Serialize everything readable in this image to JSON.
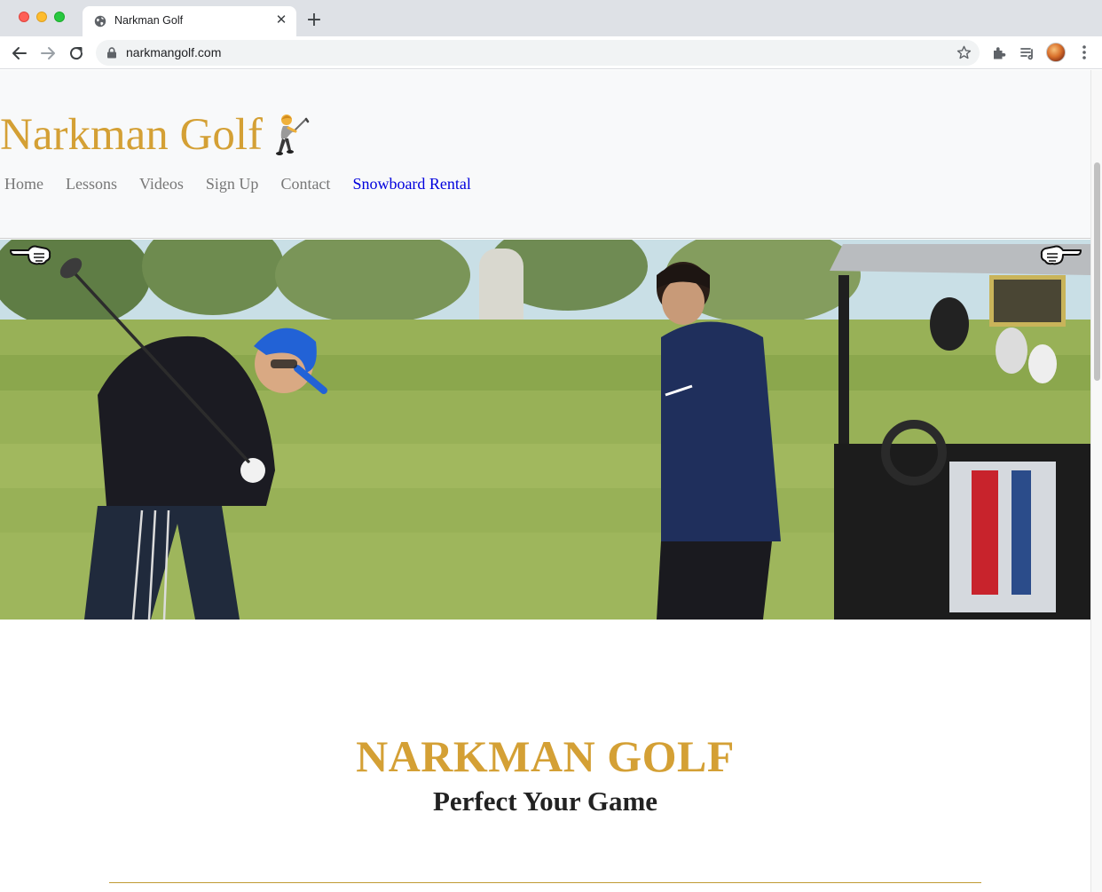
{
  "browser": {
    "tab_title": "Narkman Golf",
    "tab_close": "✕",
    "new_tab": "+",
    "url": "narkmangolf.com"
  },
  "site": {
    "brand": "Narkman Golf",
    "brand_emoji": "golfer-icon",
    "nav": [
      {
        "label": "Home"
      },
      {
        "label": "Lessons"
      },
      {
        "label": "Videos"
      },
      {
        "label": "Sign Up"
      },
      {
        "label": "Contact"
      },
      {
        "label": "Snowboard Rental"
      }
    ],
    "active_nav_index": 5,
    "hero_prev": "pointing-left-hand-icon",
    "hero_next": "pointing-right-hand-icon",
    "main_title": "NARKMAN GOLF",
    "tagline": "Perfect Your Game"
  },
  "colors": {
    "brand_gold": "#d4a035",
    "nav_gray": "#777777",
    "active_link": "#0000dd",
    "header_bg": "#f8f9fa"
  }
}
